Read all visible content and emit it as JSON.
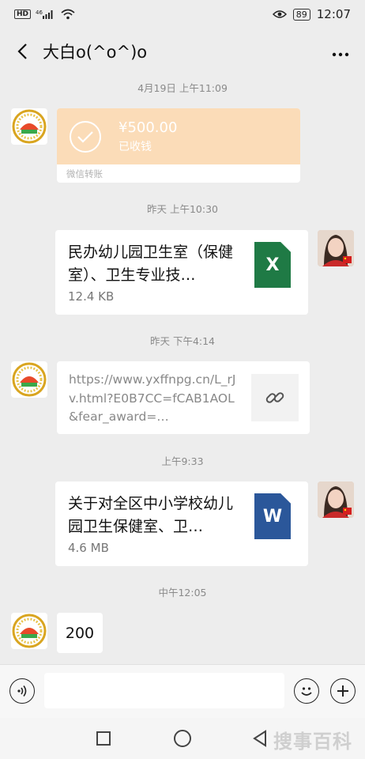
{
  "status_bar": {
    "hd": "HD",
    "signal_label": "4G",
    "battery": "89",
    "clock": "12:07"
  },
  "header": {
    "title": "大白o(^o^)o",
    "back_icon": "chevron-left-icon",
    "more_label": "···"
  },
  "messages": {
    "t1": "4月19日 上午11:09",
    "transfer": {
      "amount": "¥500.00",
      "status": "已收钱",
      "footer": "微信转账",
      "color": "#fbdcb8"
    },
    "t2": "昨天 上午10:30",
    "file1": {
      "name": "民办幼儿园卫生室（保健室）、卫生专业技…",
      "size": "12.4 KB",
      "icon_label": "X",
      "icon_color": "#1f7a45"
    },
    "t3": "昨天 下午4:14",
    "link": {
      "text": "https://www.yxffnpg.cn/L_rJv.html?E0B7CC=fCAB1AOL&fear_award=…"
    },
    "t4": "上午9:33",
    "file2": {
      "name": "关于对全区中小学校幼儿园卫生保健室、卫…",
      "size": "4.6 MB",
      "icon_label": "W",
      "icon_color": "#2b579a"
    },
    "t5": "中午12:05",
    "text_msg": "200"
  },
  "input_bar": {
    "placeholder": ""
  },
  "watermark": "搜事百科"
}
